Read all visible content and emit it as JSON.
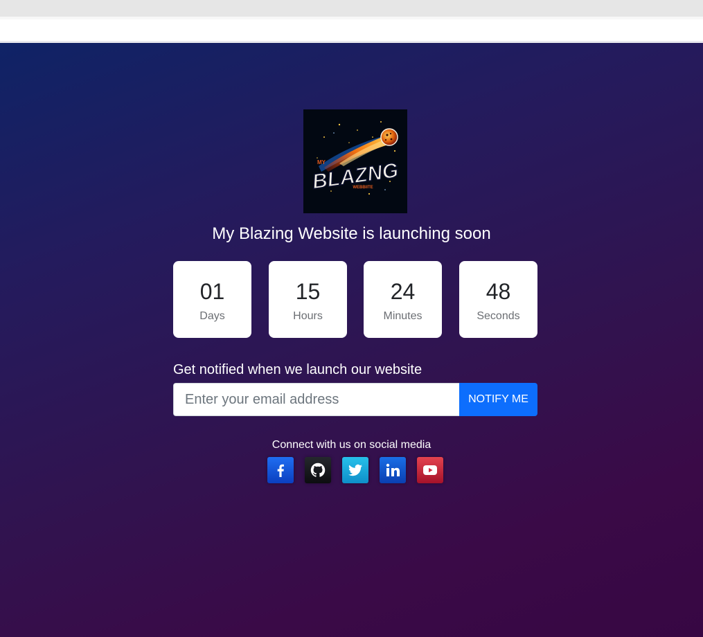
{
  "logo": {
    "line1": "MY",
    "line2": "BLAZNG",
    "line3": "WEBBIITE"
  },
  "headline": "My Blazing Website is launching soon",
  "countdown": [
    {
      "value": "01",
      "label": "Days"
    },
    {
      "value": "15",
      "label": "Hours"
    },
    {
      "value": "24",
      "label": "Minutes"
    },
    {
      "value": "48",
      "label": "Seconds"
    }
  ],
  "notify": {
    "label": "Get notified when we launch our website",
    "email_placeholder": "Enter your email address",
    "email_value": "",
    "button_label": "NOTIFY ME"
  },
  "social": {
    "label": "Connect with us on social media",
    "icons": [
      "facebook-icon",
      "github-icon",
      "twitter-icon",
      "linkedin-icon",
      "youtube-icon"
    ]
  },
  "colors": {
    "background_top": "#0f2366",
    "background_bottom": "#370743",
    "button": "#0d6efd",
    "facebook": "#1f6ef2",
    "github": "#1a1c20",
    "twitter": "#27c0ea",
    "linkedin": "#1a6fe6",
    "youtube": "#e4434f"
  }
}
